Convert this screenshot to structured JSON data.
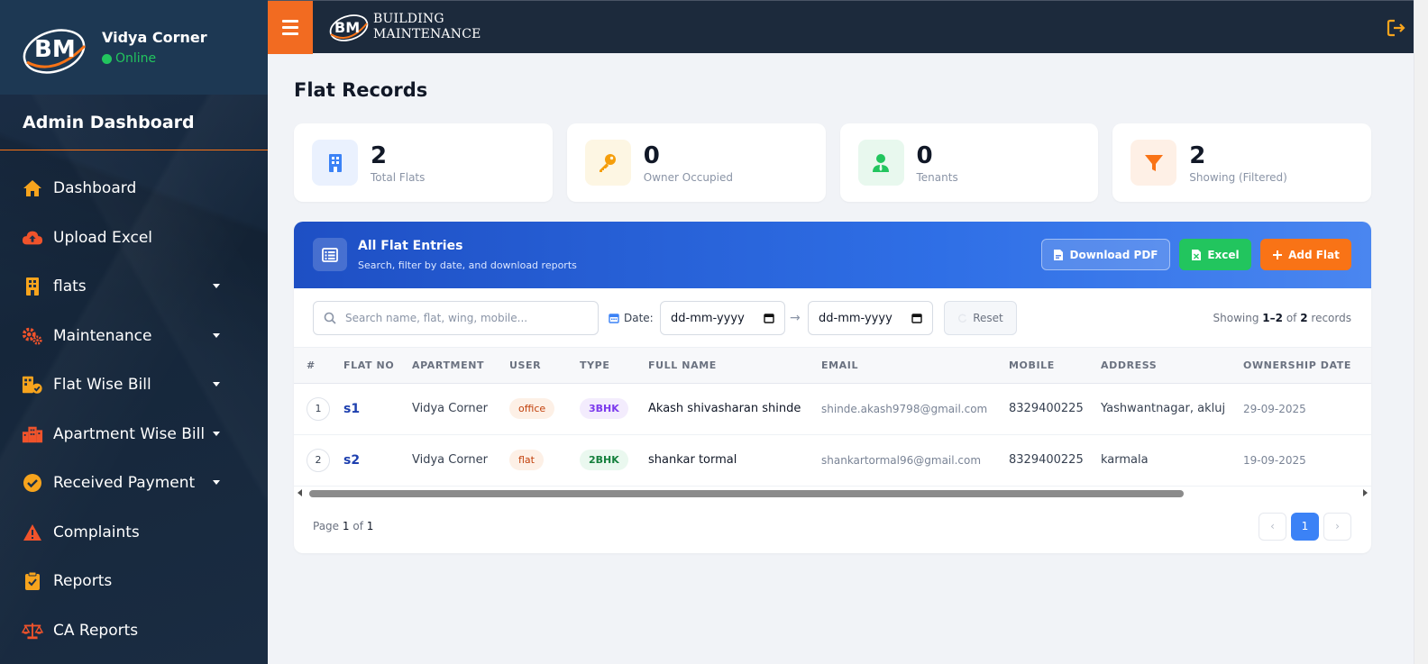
{
  "sidebar": {
    "user_name": "Vidya Corner",
    "status": "Online",
    "heading": "Admin Dashboard",
    "items": [
      {
        "label": "Dashboard",
        "icon": "home-icon"
      },
      {
        "label": "Upload Excel",
        "icon": "cloud-upload-icon"
      },
      {
        "label": "flats",
        "icon": "building-icon",
        "dropdown": true
      },
      {
        "label": "Maintenance",
        "icon": "cogs-icon",
        "dropdown": true
      },
      {
        "label": "Flat Wise Bill",
        "icon": "building-check-icon",
        "dropdown": true
      },
      {
        "label": "Apartment Wise Bill",
        "icon": "city-icon",
        "dropdown": true
      },
      {
        "label": "Received Payment",
        "icon": "check-circle-icon",
        "dropdown": true
      },
      {
        "label": "Complaints",
        "icon": "warning-icon"
      },
      {
        "label": "Reports",
        "icon": "clipboard-check-icon"
      },
      {
        "label": "CA Reports",
        "icon": "scale-icon"
      }
    ]
  },
  "topbar": {
    "brand_line1": "BUILDING",
    "brand_line2": "MAINTENANCE",
    "logo_text": "BM"
  },
  "page": {
    "title": "Flat Records"
  },
  "stats": [
    {
      "value": "2",
      "label": "Total Flats",
      "icon": "building-icon",
      "color": "#3b82f6",
      "bg": "#eaf1fe"
    },
    {
      "value": "0",
      "label": "Owner Occupied",
      "icon": "key-icon",
      "color": "#f59e0b",
      "bg": "#fdf6e3"
    },
    {
      "value": "0",
      "label": "Tenants",
      "icon": "user-tie-icon",
      "color": "#22c55e",
      "bg": "#e8f8ee"
    },
    {
      "value": "2",
      "label": "Showing (Filtered)",
      "icon": "filter-icon",
      "color": "#f97316",
      "bg": "#fef0e6"
    }
  ],
  "panel": {
    "title": "All Flat Entries",
    "subtitle": "Search, filter by date, and download reports",
    "download_pdf": "Download PDF",
    "excel": "Excel",
    "add_flat": "Add Flat"
  },
  "filters": {
    "search_placeholder": "Search name, flat, wing, mobile...",
    "date_label": "Date:",
    "date_from_placeholder": "dd-mm-yyyy",
    "date_to_placeholder": "dd-mm-yyyy",
    "reset": "Reset",
    "showing_prefix": "Showing",
    "showing_range": "1–2",
    "showing_of": "of",
    "showing_total": "2",
    "showing_suffix": "records"
  },
  "table": {
    "columns": [
      "#",
      "FLAT NO",
      "APARTMENT",
      "USER",
      "TYPE",
      "FULL NAME",
      "EMAIL",
      "MOBILE",
      "ADDRESS",
      "OWNERSHIP DATE"
    ],
    "rows": [
      {
        "num": "1",
        "flat_no": "s1",
        "apartment": "Vidya Corner",
        "user": "office",
        "type": "3BHK",
        "full_name": "Akash shivasharan shinde",
        "email": "shinde.akash9798@gmail.com",
        "mobile": "8329400225",
        "address": "Yashwantnagar, akluj",
        "ownership_date": "29-09-2025"
      },
      {
        "num": "2",
        "flat_no": "s2",
        "apartment": "Vidya Corner",
        "user": "flat",
        "type": "2BHK",
        "full_name": "shankar tormal",
        "email": "shankartormal96@gmail.com",
        "mobile": "8329400225",
        "address": "karmala",
        "ownership_date": "19-09-2025"
      }
    ]
  },
  "pagination": {
    "page_label": "Page",
    "current": "1",
    "of": "of",
    "total": "1",
    "active_page": "1",
    "prev": "‹",
    "next": "›"
  },
  "colors": {
    "accent_orange": "#f97316",
    "primary_blue": "#2f6fe6",
    "sidebar_bg": "#15263a",
    "online_green": "#22c55e"
  }
}
